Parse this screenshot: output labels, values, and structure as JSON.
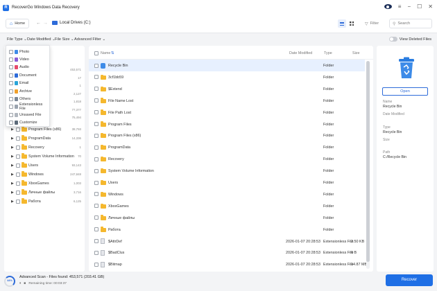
{
  "app": {
    "title": "RecoverGo Windows Data Recovery"
  },
  "toolbar": {
    "home_label": "Home",
    "location": "Local Drives (C:)",
    "filter_label": "Filter",
    "search_placeholder": "Search"
  },
  "filters": {
    "file_type": "File Type",
    "date_modified": "Date Modified",
    "file_size": "File Size",
    "advanced": "Advanced Filter",
    "view_deleted": "View Deleted Files"
  },
  "file_type_menu": [
    "Photo",
    "Video",
    "Audio",
    "Document",
    "Email",
    "Archive",
    "Others",
    "Extensionless File",
    "Unsaved File",
    "Customize"
  ],
  "file_type_colors": [
    "#3d8be8",
    "#8a5cd6",
    "#e64b6b",
    "#2d6bd9",
    "#2aa4d8",
    "#f0a02c",
    "#7a8796",
    "#9aa3ae",
    "#b0b6be",
    "#5d6b7a"
  ],
  "tree": {
    "partial_counts": [
      "453,571",
      "17",
      "1",
      "2,127",
      "1,818",
      "77,377",
      "75,494"
    ],
    "items": [
      {
        "name": "Program Files (x86)",
        "count": "39,793"
      },
      {
        "name": "ProgramData",
        "count": "14,336"
      },
      {
        "name": "Recovery",
        "count": "1"
      },
      {
        "name": "System Volume Information",
        "count": "70"
      },
      {
        "name": "Users",
        "count": "93,143"
      },
      {
        "name": "Windows",
        "count": "247,848"
      },
      {
        "name": "XboxGames",
        "count": "1,003"
      },
      {
        "name": "Личные файлы",
        "count": "3,716"
      },
      {
        "name": "Работа",
        "count": "6,125"
      }
    ]
  },
  "table": {
    "columns": {
      "name": "Name",
      "date": "Date Modified",
      "type": "Type",
      "size": "Size"
    },
    "rows": [
      {
        "name": "Recycle Bin",
        "date": "",
        "type": "Folder",
        "size": "",
        "icon": "recycle-bin",
        "selected": true
      },
      {
        "name": "3cf1bb59",
        "date": "",
        "type": "Folder",
        "size": "",
        "icon": "folder"
      },
      {
        "name": "$Extend",
        "date": "",
        "type": "Folder",
        "size": "",
        "icon": "folder"
      },
      {
        "name": "File Name Lost",
        "date": "",
        "type": "Folder",
        "size": "",
        "icon": "folder"
      },
      {
        "name": "File Path Lost",
        "date": "",
        "type": "Folder",
        "size": "",
        "icon": "folder"
      },
      {
        "name": "Program Files",
        "date": "",
        "type": "Folder",
        "size": "",
        "icon": "folder"
      },
      {
        "name": "Program Files (x86)",
        "date": "",
        "type": "Folder",
        "size": "",
        "icon": "folder"
      },
      {
        "name": "ProgramData",
        "date": "",
        "type": "Folder",
        "size": "",
        "icon": "folder"
      },
      {
        "name": "Recovery",
        "date": "",
        "type": "Folder",
        "size": "",
        "icon": "folder"
      },
      {
        "name": "System Volume Information",
        "date": "",
        "type": "Folder",
        "size": "",
        "icon": "folder"
      },
      {
        "name": "Users",
        "date": "",
        "type": "Folder",
        "size": "",
        "icon": "folder"
      },
      {
        "name": "Windows",
        "date": "",
        "type": "Folder",
        "size": "",
        "icon": "folder"
      },
      {
        "name": "XboxGames",
        "date": "",
        "type": "Folder",
        "size": "",
        "icon": "folder"
      },
      {
        "name": "Личные файлы",
        "date": "",
        "type": "Folder",
        "size": "",
        "icon": "folder"
      },
      {
        "name": "Работа",
        "date": "",
        "type": "Folder",
        "size": "",
        "icon": "folder"
      },
      {
        "name": "$AttrDef",
        "date": "2026-01-07 20:28:53",
        "type": "Extensionless File",
        "size": "2.50 KB",
        "icon": "file"
      },
      {
        "name": "$BadClus",
        "date": "2026-01-07 20:28:53",
        "type": "Extensionless File",
        "size": "0 B",
        "icon": "file"
      },
      {
        "name": "$Bitmap",
        "date": "2026-01-07 20:28:53",
        "type": "Extensionless File",
        "size": "14.87 MB",
        "icon": "file"
      }
    ]
  },
  "details": {
    "open_label": "Open",
    "name_label": "Name",
    "name_value": "Recycle Bin",
    "date_label": "Date Modified",
    "type_label": "Type",
    "type_value": "Recycle Bin",
    "size_label": "Size",
    "path_label": "Path",
    "path_value": "C:/Recycle Bin"
  },
  "status": {
    "progress_percent": 44,
    "progress_text": "44%",
    "scan_text": "Advanced Scan - Files found: 453,571 (203.41 GB)",
    "remaining": "Remaining time: 00:03:37",
    "recover_label": "Recover"
  }
}
